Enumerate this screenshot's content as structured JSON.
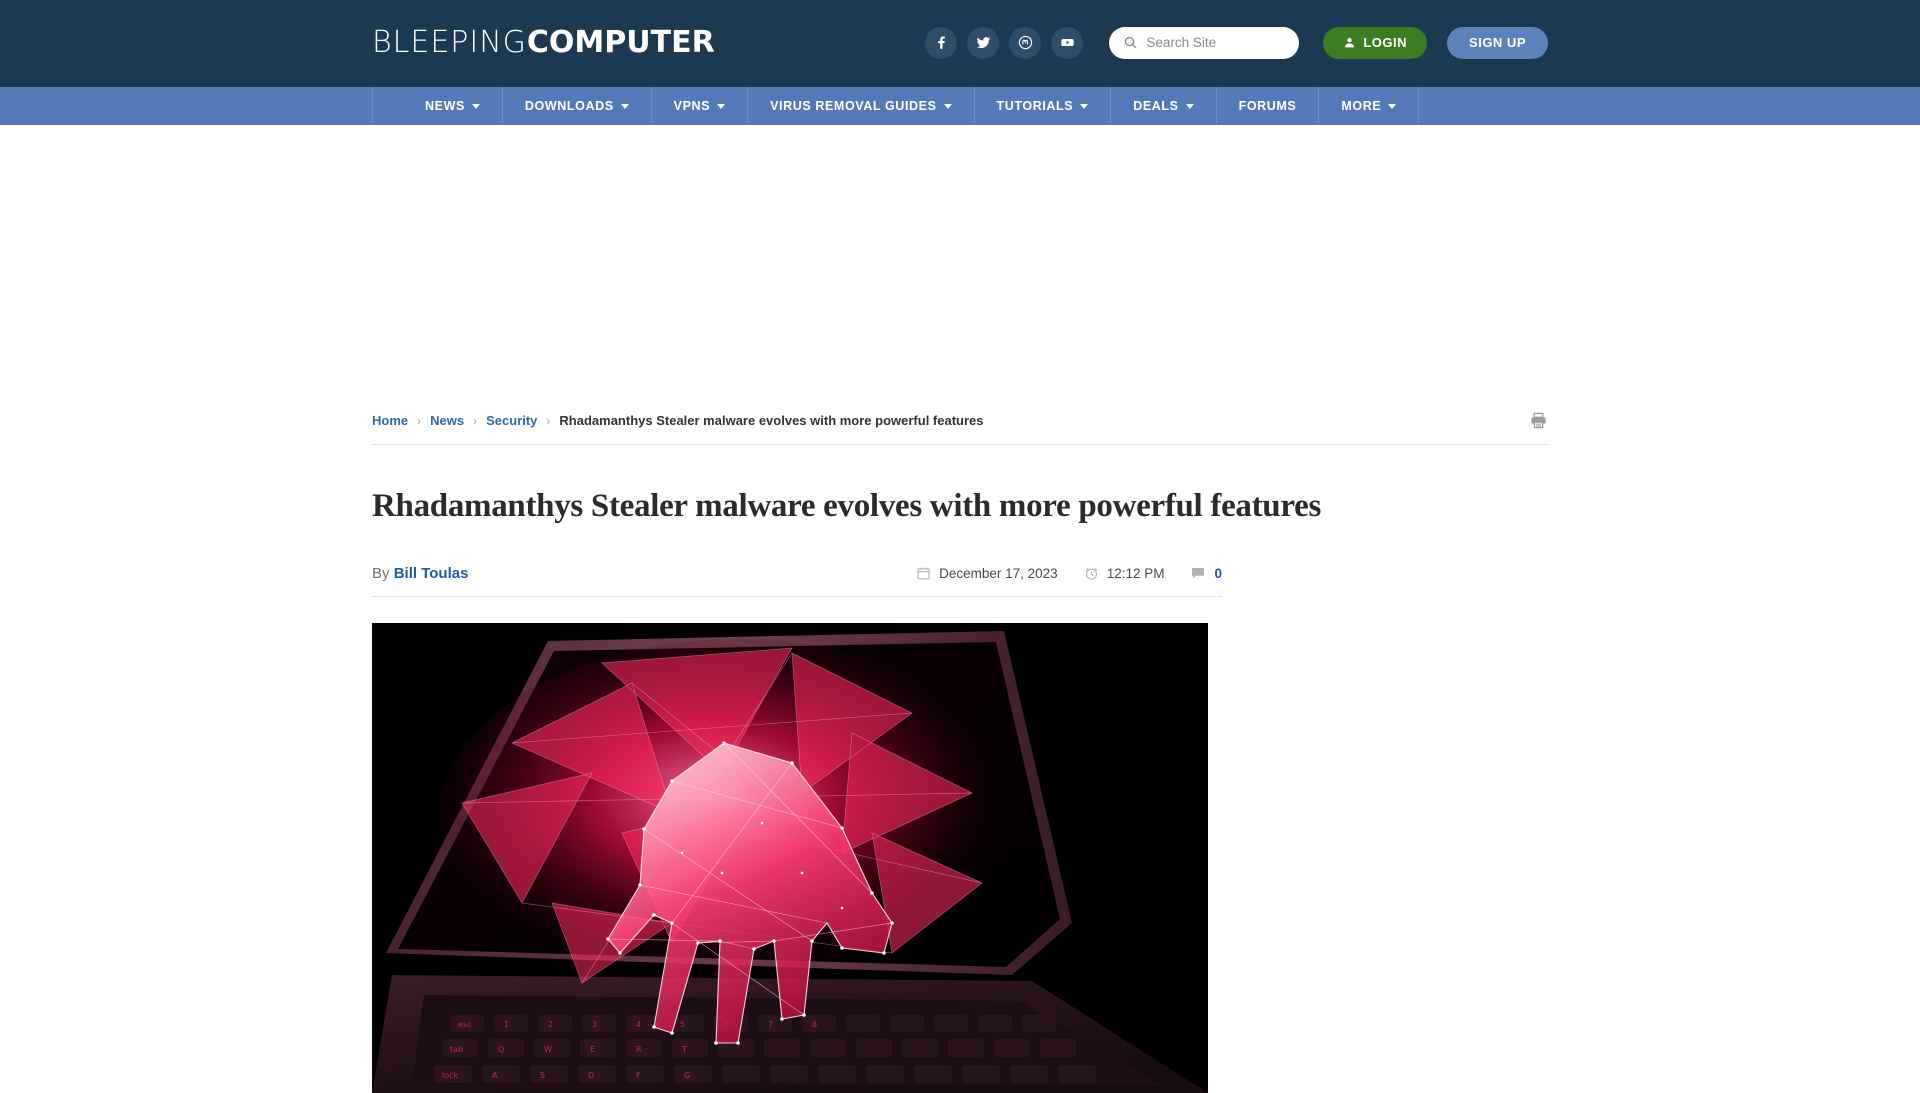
{
  "site": {
    "logo_thin": "BLEEPING",
    "logo_bold": "COMPUTER",
    "brand_dark": "#1d3851",
    "brand_nav": "#5579b8",
    "accent_link": "#2e6bb0",
    "login_green": "#3c7d22",
    "signup_blue": "#5d81bd"
  },
  "header": {
    "social": [
      {
        "name": "facebook-icon",
        "label": "Facebook"
      },
      {
        "name": "twitter-icon",
        "label": "Twitter"
      },
      {
        "name": "mastodon-icon",
        "label": "Mastodon"
      },
      {
        "name": "youtube-icon",
        "label": "YouTube"
      }
    ],
    "search": {
      "placeholder": "Search Site",
      "value": ""
    },
    "login_label": "LOGIN",
    "signup_label": "SIGN UP"
  },
  "nav": {
    "items": [
      {
        "label": "NEWS",
        "caret": true
      },
      {
        "label": "DOWNLOADS",
        "caret": true
      },
      {
        "label": "VPNS",
        "caret": true
      },
      {
        "label": "VIRUS REMOVAL GUIDES",
        "caret": true
      },
      {
        "label": "TUTORIALS",
        "caret": true
      },
      {
        "label": "DEALS",
        "caret": true
      },
      {
        "label": "FORUMS",
        "caret": false
      },
      {
        "label": "MORE",
        "caret": true
      }
    ]
  },
  "breadcrumb": {
    "items": [
      {
        "label": "Home",
        "link": true
      },
      {
        "label": "News",
        "link": true
      },
      {
        "label": "Security",
        "link": true
      },
      {
        "label": "Rhadamanthys Stealer malware evolves with more powerful features",
        "link": false
      }
    ],
    "separator": "›",
    "print_label": "Print"
  },
  "article": {
    "title": "Rhadamanthys Stealer malware evolves with more powerful features",
    "by_label": "By",
    "author": "Bill Toulas",
    "date": "December 17, 2023",
    "time": "12:12 PM",
    "comment_count": "0",
    "hero_alt": "Red polygonal hand emerging from a laptop screen"
  }
}
